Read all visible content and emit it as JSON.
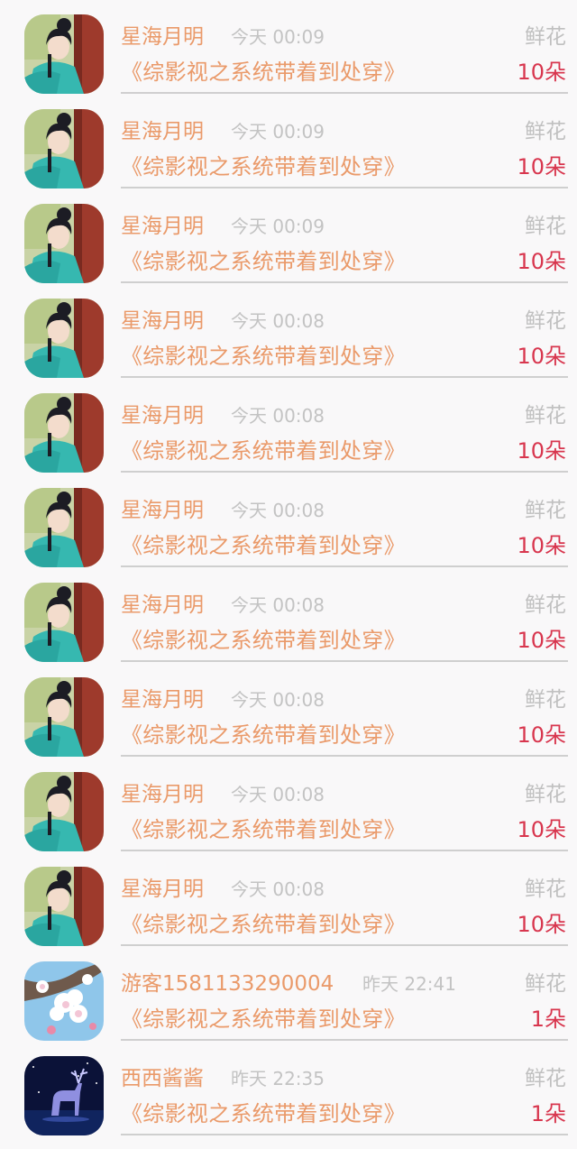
{
  "colors": {
    "background": "#f9f8f9",
    "name": "#ea9a6a",
    "time": "#c3c3c3",
    "gift_label": "#c0c0c0",
    "count": "#d8364e",
    "divider": "#cfcfcf"
  },
  "rows": [
    {
      "avatar": "costume-girl-avatar",
      "name": "星海月明",
      "time": "今天 00:09",
      "gift": "鲜花",
      "book": "《综影视之系统带着到处穿》",
      "count": "10朵"
    },
    {
      "avatar": "costume-girl-avatar",
      "name": "星海月明",
      "time": "今天 00:09",
      "gift": "鲜花",
      "book": "《综影视之系统带着到处穿》",
      "count": "10朵"
    },
    {
      "avatar": "costume-girl-avatar",
      "name": "星海月明",
      "time": "今天 00:09",
      "gift": "鲜花",
      "book": "《综影视之系统带着到处穿》",
      "count": "10朵"
    },
    {
      "avatar": "costume-girl-avatar",
      "name": "星海月明",
      "time": "今天 00:08",
      "gift": "鲜花",
      "book": "《综影视之系统带着到处穿》",
      "count": "10朵"
    },
    {
      "avatar": "costume-girl-avatar",
      "name": "星海月明",
      "time": "今天 00:08",
      "gift": "鲜花",
      "book": "《综影视之系统带着到处穿》",
      "count": "10朵"
    },
    {
      "avatar": "costume-girl-avatar",
      "name": "星海月明",
      "time": "今天 00:08",
      "gift": "鲜花",
      "book": "《综影视之系统带着到处穿》",
      "count": "10朵"
    },
    {
      "avatar": "costume-girl-avatar",
      "name": "星海月明",
      "time": "今天 00:08",
      "gift": "鲜花",
      "book": "《综影视之系统带着到处穿》",
      "count": "10朵"
    },
    {
      "avatar": "costume-girl-avatar",
      "name": "星海月明",
      "time": "今天 00:08",
      "gift": "鲜花",
      "book": "《综影视之系统带着到处穿》",
      "count": "10朵"
    },
    {
      "avatar": "costume-girl-avatar",
      "name": "星海月明",
      "time": "今天 00:08",
      "gift": "鲜花",
      "book": "《综影视之系统带着到处穿》",
      "count": "10朵"
    },
    {
      "avatar": "costume-girl-avatar",
      "name": "星海月明",
      "time": "今天 00:08",
      "gift": "鲜花",
      "book": "《综影视之系统带着到处穿》",
      "count": "10朵"
    },
    {
      "avatar": "blossom-avatar",
      "name": "游客1581133290004",
      "time": "昨天 22:41",
      "gift": "鲜花",
      "book": "《综影视之系统带着到处穿》",
      "count": "1朵"
    },
    {
      "avatar": "deer-avatar",
      "name": "西西酱酱",
      "time": "昨天 22:35",
      "gift": "鲜花",
      "book": "《综影视之系统带着到处穿》",
      "count": "1朵"
    }
  ]
}
